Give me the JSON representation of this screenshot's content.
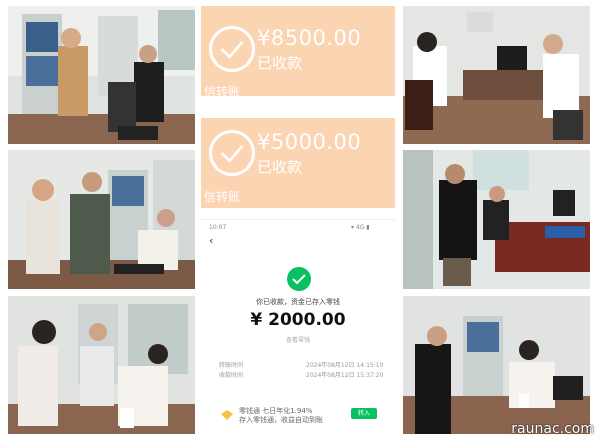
{
  "payment_cards": [
    {
      "amount": "¥8500.00",
      "status": "已收款",
      "transfer": "信转账"
    },
    {
      "amount": "¥5000.00",
      "status": "已收款",
      "transfer": "信转账"
    }
  ],
  "phone": {
    "status_time": "10:07",
    "status_icons": "▾ 4G ▮",
    "back": "‹",
    "message": "你已收款，资金已存入零钱",
    "amount": "¥ 2000.00",
    "hint": "查看零钱",
    "rows": [
      {
        "label": "转账时间",
        "value": "2024年08月12日 14:15:10"
      },
      {
        "label": "收款时间",
        "value": "2024年08月12日 15:37:20"
      }
    ],
    "promo_line1": "零钱通 七日年化1.94%",
    "promo_line2": "存入零钱通，收益自动到账",
    "promo_button": "转入"
  },
  "watermark": "raunac.com",
  "colors": {
    "card_bg": "#fbd4b2",
    "wechat_green": "#07c160"
  }
}
